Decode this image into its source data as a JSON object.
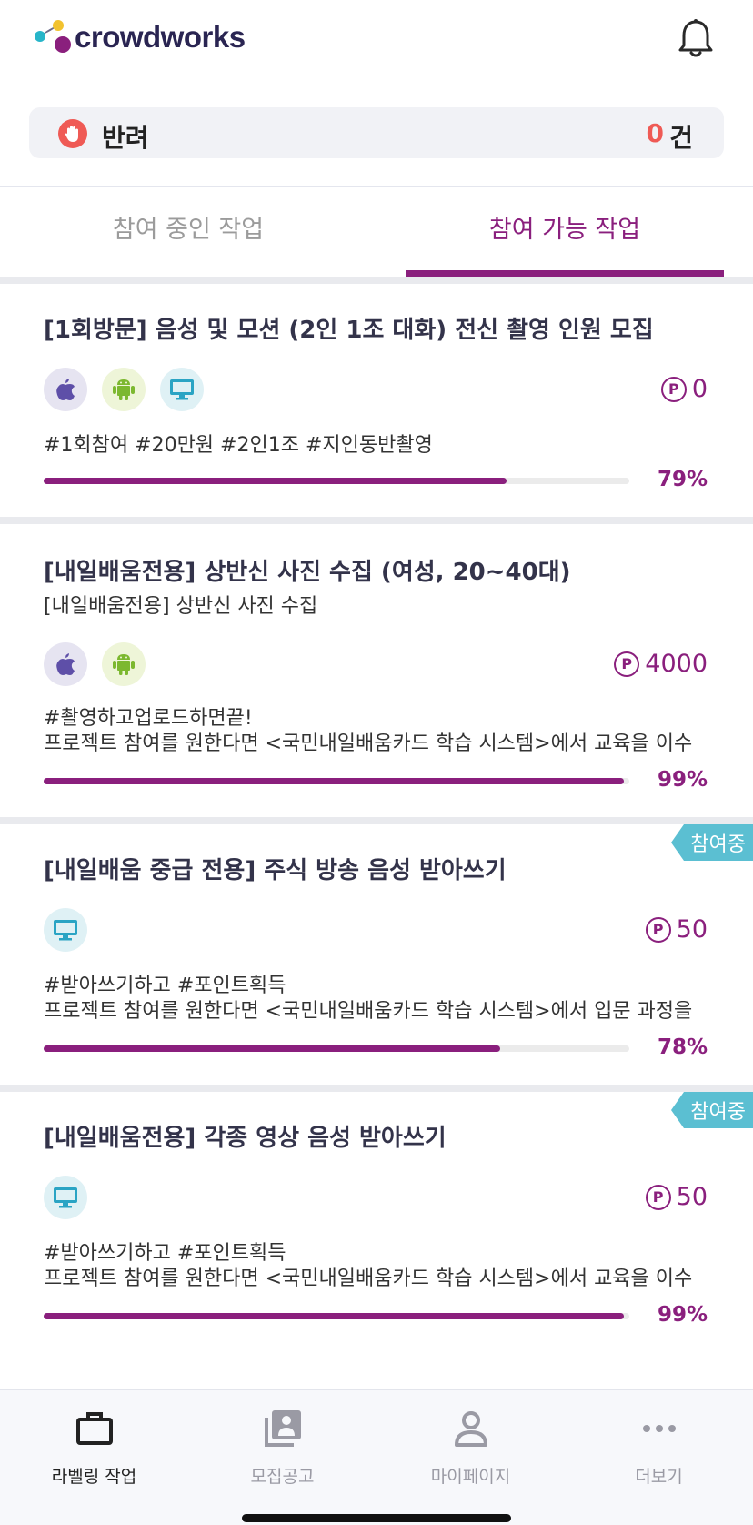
{
  "header": {
    "logo_text": "crowdworks",
    "bell_icon": "bell-icon"
  },
  "reject": {
    "icon": "hand-stop-icon",
    "label": "반려",
    "count": "0",
    "unit": "건"
  },
  "tabs": {
    "ongoing": "참여 중인 작업",
    "available": "참여 가능 작업",
    "active": "available"
  },
  "colors": {
    "accent": "#8a1f7d",
    "reject": "#ef5a55",
    "badge": "#5bbfd2"
  },
  "cards": [
    {
      "title": "[1회방문] 음성 및 모션 (2인 1조 대화) 전신 촬영 인원 모집",
      "subtitle": "",
      "platforms": [
        "ios",
        "android",
        "pc"
      ],
      "points": "0",
      "tags": "#1회참여 #20만원 #2인1조 #지인동반촬영",
      "description": "",
      "progress": 0.79,
      "progress_label": "79%",
      "badge": ""
    },
    {
      "title": "[내일배움전용] 상반신 사진 수집 (여성, 20~40대)",
      "subtitle": "[내일배움전용] 상반신 사진 수집",
      "platforms": [
        "ios",
        "android"
      ],
      "points": "4000",
      "tags": "#촬영하고업로드하면끝!",
      "description": "프로젝트 참여를 원한다면 <국민내일배움카드 학습 시스템>에서 교육을 이수",
      "progress": 0.99,
      "progress_label": "99%",
      "badge": ""
    },
    {
      "title": "[내일배움 중급 전용] 주식 방송 음성 받아쓰기",
      "subtitle": "",
      "platforms": [
        "pc"
      ],
      "points": "50",
      "tags": "#받아쓰기하고 #포인트획득",
      "description": "프로젝트 참여를 원한다면 <국민내일배움카드 학습 시스템>에서 입문 과정을",
      "progress": 0.78,
      "progress_label": "78%",
      "badge": "참여중"
    },
    {
      "title": "[내일배움전용] 각종 영상 음성 받아쓰기",
      "subtitle": "",
      "platforms": [
        "pc"
      ],
      "points": "50",
      "tags": "#받아쓰기하고 #포인트획득",
      "description": "프로젝트 참여를 원한다면 <국민내일배움카드 학습 시스템>에서 교육을 이수",
      "progress": 0.99,
      "progress_label": "99%",
      "badge": "참여중"
    }
  ],
  "bottom_nav": [
    {
      "label": "라벨링 작업",
      "icon": "briefcase-icon",
      "active": true
    },
    {
      "label": "모집공고",
      "icon": "notice-board-icon",
      "active": false
    },
    {
      "label": "마이페이지",
      "icon": "person-icon",
      "active": false
    },
    {
      "label": "더보기",
      "icon": "more-dots-icon",
      "active": false
    }
  ]
}
